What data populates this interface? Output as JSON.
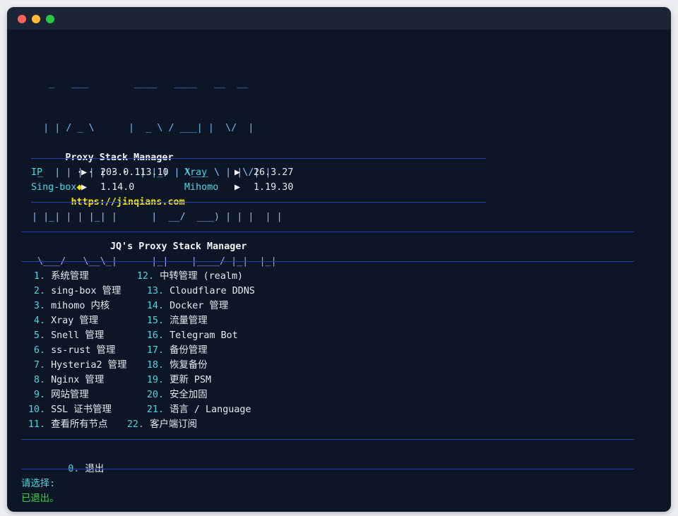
{
  "window": {
    "colors": {
      "bg": "#0d1627",
      "titlebar": "#1b2536",
      "rule": "#2b3fa8",
      "cyan": "#49d6e0",
      "yellow": "#f2e600",
      "green": "#37d33f"
    }
  },
  "banner": {
    "ascii": [
      "   _   ___        ____   ____   __  __",
      "  | | / _ \\      |  _ \\ / ___| |  \\/  |",
      " _  | | | | |      | |_) | \\___ \\ | |\\/| |",
      "| |_| | | |_| |      |  __/  ___) | | |  | |",
      " \\___/   \\__\\_|      |_|    |____/ |_|  |_|"
    ],
    "app_name": "Proxy Stack Manager",
    "dots": "· · · · ·",
    "diamond": "◆",
    "url": "https://jinqians.com"
  },
  "status": {
    "arrow": "▶",
    "rows": [
      [
        {
          "label": "IP",
          "value": "203.0.113.10"
        },
        {
          "label": "Xray",
          "value": "26.3.27"
        }
      ],
      [
        {
          "label": "Sing-box",
          "value": "1.14.0"
        },
        {
          "label": "Mihomo",
          "value": "1.19.30"
        }
      ]
    ]
  },
  "menu": {
    "title": "JQ's Proxy Stack Manager",
    "left": [
      {
        "num": "1.",
        "label": "系统管理"
      },
      {
        "num": "2.",
        "label": "sing-box 管理"
      },
      {
        "num": "3.",
        "label": "mihomo 内核"
      },
      {
        "num": "4.",
        "label": "Xray 管理"
      },
      {
        "num": "5.",
        "label": "Snell 管理"
      },
      {
        "num": "6.",
        "label": "ss-rust 管理"
      },
      {
        "num": "7.",
        "label": "Hysteria2 管理"
      },
      {
        "num": "8.",
        "label": "Nginx 管理"
      },
      {
        "num": "9.",
        "label": "网站管理"
      },
      {
        "num": "10.",
        "label": "SSL 证书管理"
      },
      {
        "num": "11.",
        "label": "查看所有节点"
      }
    ],
    "right": [
      {
        "num": "12.",
        "label": "中转管理 (realm)"
      },
      {
        "num": "13.",
        "label": "Cloudflare DDNS"
      },
      {
        "num": "14.",
        "label": "Docker 管理"
      },
      {
        "num": "15.",
        "label": "流量管理"
      },
      {
        "num": "16.",
        "label": "Telegram Bot"
      },
      {
        "num": "17.",
        "label": "备份管理"
      },
      {
        "num": "18.",
        "label": "恢复备份"
      },
      {
        "num": "19.",
        "label": "更新 PSM"
      },
      {
        "num": "20.",
        "label": "安全加固"
      },
      {
        "num": "21.",
        "label": "语言 / Language"
      },
      {
        "num": "22.",
        "label": "客户端订阅"
      }
    ],
    "exit": {
      "num": "0.",
      "label": "退出"
    }
  },
  "prompt": {
    "label": "请选择:",
    "result": "已退出。"
  }
}
